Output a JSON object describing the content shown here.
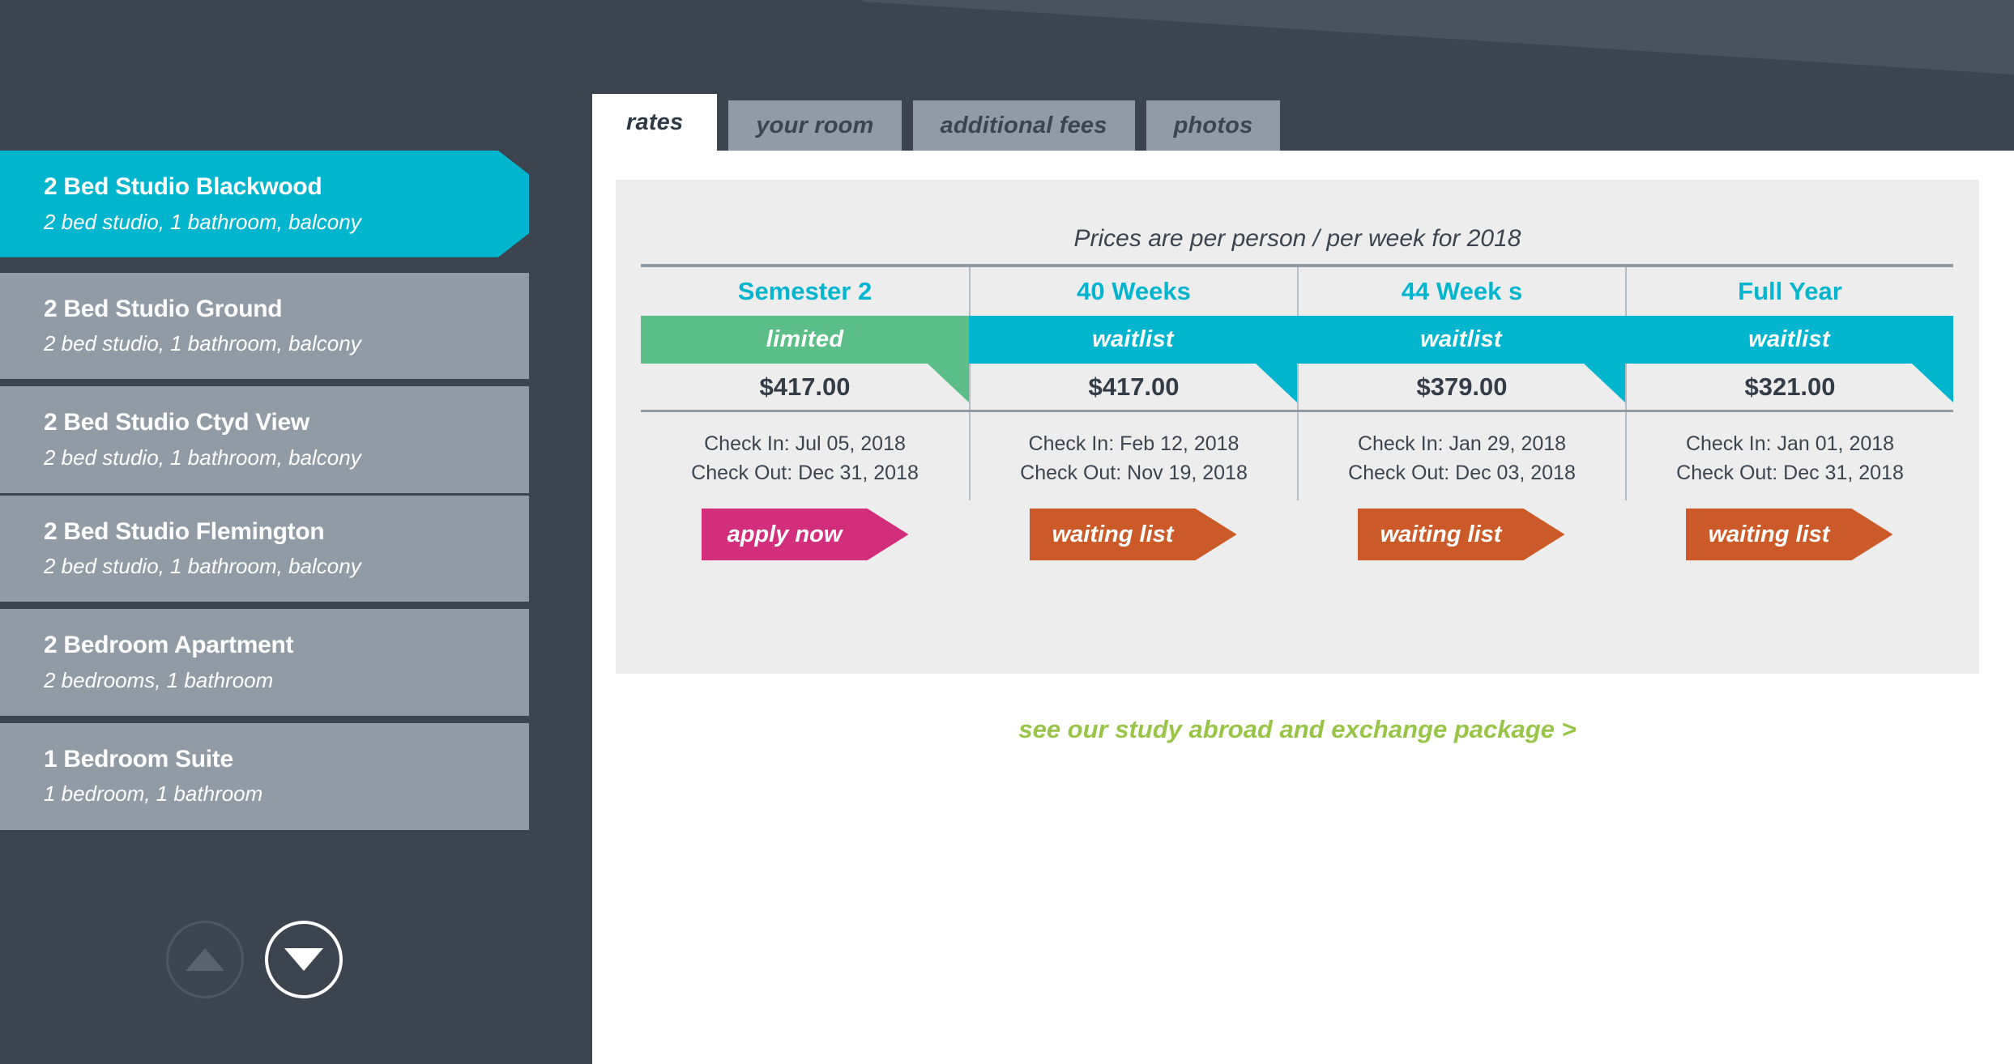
{
  "sidebar": {
    "rooms": [
      {
        "name": "2 Bed Studio Blackwood",
        "desc": "2 bed studio, 1 bathroom, balcony",
        "selected": true
      },
      {
        "name": "2 Bed Studio Ground",
        "desc": "2 bed studio, 1 bathroom, balcony",
        "selected": false
      },
      {
        "name": "2 Bed Studio Ctyd View",
        "desc": "2 bed studio, 1 bathroom, balcony",
        "selected": false
      },
      {
        "name": "2 Bed Studio Flemington",
        "desc": "2 bed studio, 1 bathroom, balcony",
        "selected": false
      },
      {
        "name": "2 Bedroom Apartment",
        "desc": "2 bedrooms, 1 bathroom",
        "selected": false
      },
      {
        "name": "1 Bedroom Suite",
        "desc": "1 bedroom, 1 bathroom",
        "selected": false
      }
    ],
    "nav": {
      "up_icon": "triangle-up-icon",
      "down_icon": "triangle-down-icon",
      "up_enabled": false,
      "down_enabled": true
    }
  },
  "tabs": [
    {
      "label": "rates",
      "active": true
    },
    {
      "label": "your room",
      "active": false
    },
    {
      "label": "additional fees",
      "active": false
    },
    {
      "label": "photos",
      "active": false
    }
  ],
  "rates": {
    "caption": "Prices are per person / per week for 2018",
    "columns": [
      {
        "header": "Semester 2",
        "status": "limited",
        "status_color": "#5abe86",
        "price": "$417.00",
        "check_in": "Check In: Jul 05, 2018",
        "check_out": "Check Out: Dec 31, 2018",
        "action_label": "apply now",
        "action_color": "#d32d7d"
      },
      {
        "header": "40 Weeks",
        "status": "waitlist",
        "status_color": "#00b5cd",
        "price": "$417.00",
        "check_in": "Check In: Feb 12, 2018",
        "check_out": "Check Out: Nov 19, 2018",
        "action_label": "waiting list",
        "action_color": "#cc5a28"
      },
      {
        "header": "44 Week s",
        "status": "waitlist",
        "status_color": "#00b5cd",
        "price": "$379.00",
        "check_in": "Check In: Jan 29, 2018",
        "check_out": "Check Out: Dec 03, 2018",
        "action_label": "waiting list",
        "action_color": "#cc5a28"
      },
      {
        "header": "Full Year",
        "status": "waitlist",
        "status_color": "#00b5cd",
        "price": "$321.00",
        "check_in": "Check In: Jan 01, 2018",
        "check_out": "Check Out: Dec 31, 2018",
        "action_label": "waiting list",
        "action_color": "#cc5a28"
      }
    ]
  },
  "footer": {
    "package_link": "see our study abroad and exchange package >"
  },
  "colors": {
    "cyan": "#00b5cd",
    "green": "#5abe86",
    "pink": "#d32d7d",
    "orange": "#cc5a28",
    "lime": "#98c548",
    "dark": "#3c444f",
    "gray": "#909ba6",
    "panel": "#ededed"
  }
}
